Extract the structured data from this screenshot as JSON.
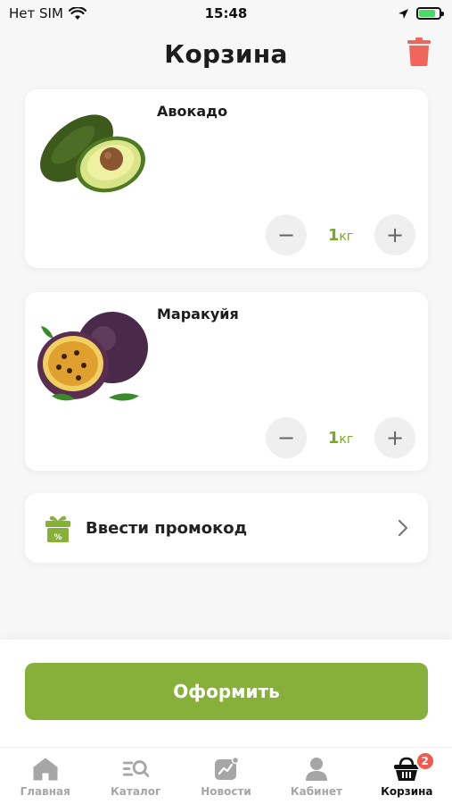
{
  "status_bar": {
    "carrier": "Нет SIM",
    "time": "15:48",
    "battery_level": 0.8
  },
  "header": {
    "title": "Корзина"
  },
  "products": [
    {
      "name": "Авокадо",
      "quantity": "1",
      "unit": "кг",
      "minus": "−",
      "plus": "+"
    },
    {
      "name": "Маракуйя",
      "quantity": "1",
      "unit": "кг",
      "minus": "−",
      "plus": "+"
    }
  ],
  "promo": {
    "label": "Ввести промокод"
  },
  "checkout": {
    "label": "Оформить"
  },
  "tabs": [
    {
      "label": "Главная",
      "icon": "home-icon"
    },
    {
      "label": "Каталог",
      "icon": "catalog-search-icon"
    },
    {
      "label": "Новости",
      "icon": "news-icon"
    },
    {
      "label": "Кабинет",
      "icon": "profile-icon"
    },
    {
      "label": "Корзина",
      "icon": "basket-icon",
      "badge": "2",
      "active": true
    }
  ],
  "colors": {
    "accent": "#86b03a",
    "qty": "#7aa82b",
    "danger": "#f0665a",
    "badge": "#f05a4f"
  }
}
